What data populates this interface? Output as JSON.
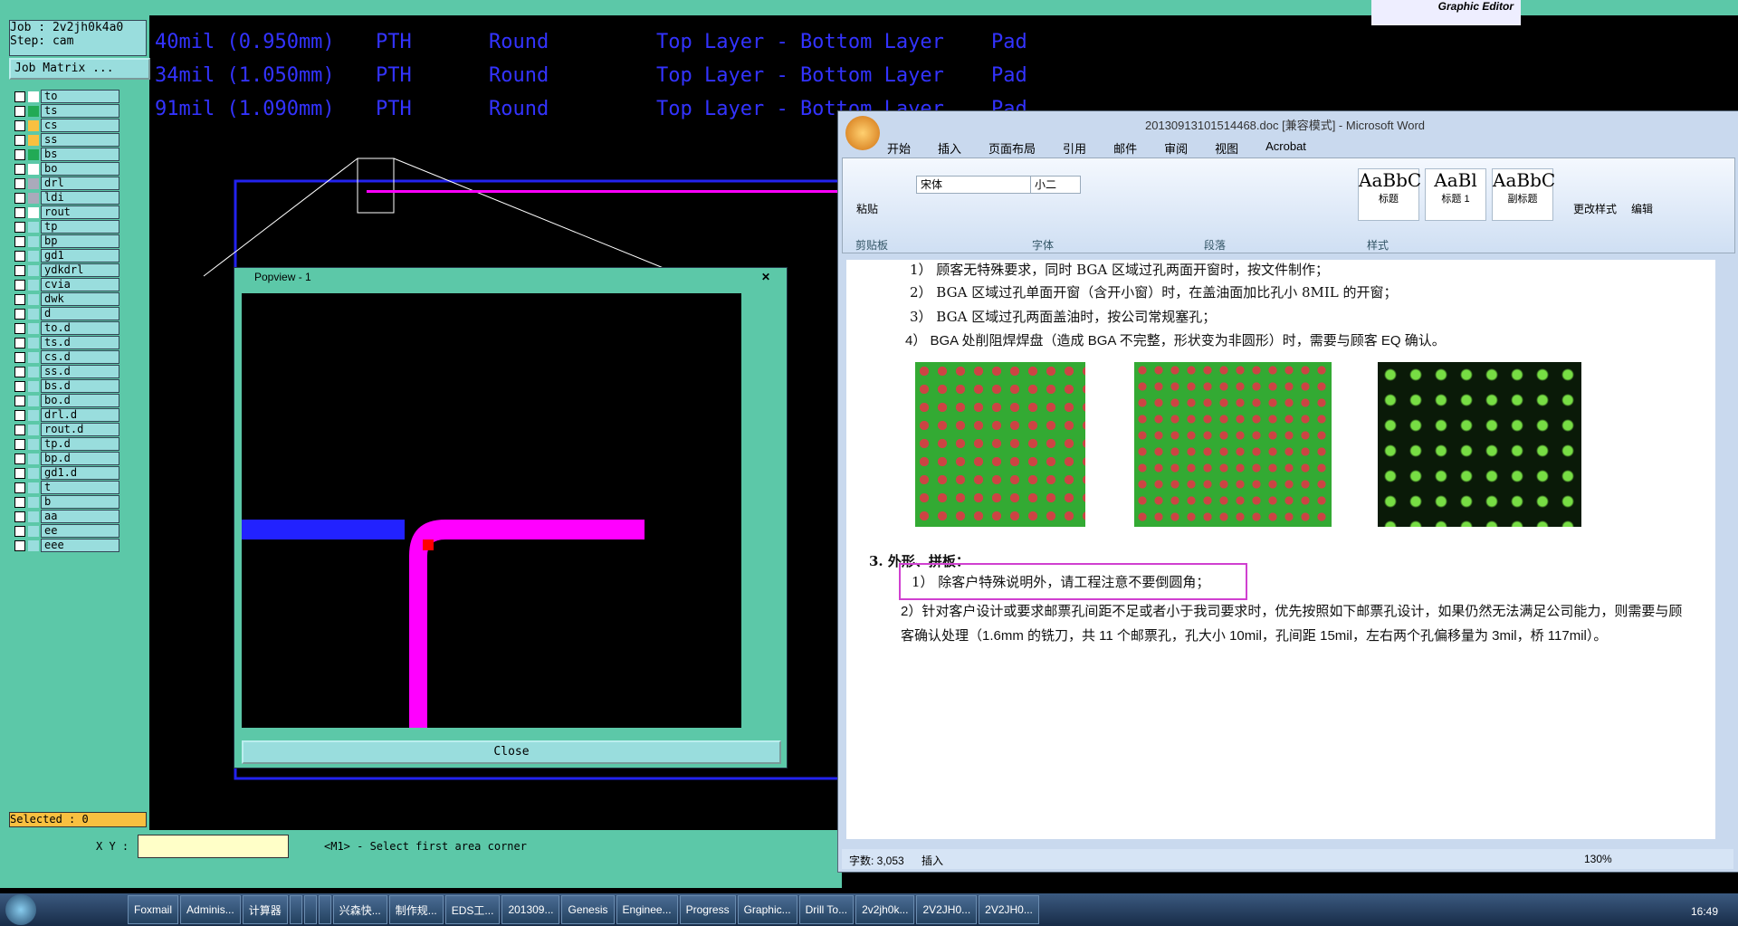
{
  "genesis": {
    "job": "Job : 2v2jh0k4a0",
    "step": "Step: cam",
    "job_matrix": "Job Matrix ...",
    "selected": "Selected : 0",
    "xy_label": "X Y :",
    "status": "<M1> - Select first area corner",
    "title": "Graphic Editor",
    "rows": [
      [
        "40mil (0.950mm)",
        "PTH",
        "Round",
        "Top Layer - Bottom Layer",
        "Pad"
      ],
      [
        "34mil (1.050mm)",
        "PTH",
        "Round",
        "Top Layer - Bottom Layer",
        "Pad"
      ],
      [
        "91mil (1.090mm)",
        "PTH",
        "Round",
        "Top Layer - Bottom Layer",
        "Pad"
      ]
    ],
    "layers": [
      {
        "n": "to",
        "c": "#fff"
      },
      {
        "n": "ts",
        "c": "#22aa55"
      },
      {
        "n": "cs",
        "c": "#f8c040"
      },
      {
        "n": "ss",
        "c": "#f8c040"
      },
      {
        "n": "bs",
        "c": "#22aa55"
      },
      {
        "n": "bo",
        "c": "#fff"
      },
      {
        "n": "drl",
        "c": "#aab"
      },
      {
        "n": "ldi",
        "c": "#aab"
      },
      {
        "n": "rout",
        "c": "#fff"
      },
      {
        "n": "tp",
        "c": "#9dd"
      },
      {
        "n": "bp",
        "c": "#9dd"
      },
      {
        "n": "gd1",
        "c": "#9dd"
      },
      {
        "n": "ydkdrl",
        "c": "#9dd"
      },
      {
        "n": "cvia",
        "c": "#9dd"
      },
      {
        "n": "dwk",
        "c": "#9dd"
      },
      {
        "n": "d",
        "c": "#9dd"
      },
      {
        "n": "to.d",
        "c": "#9dd"
      },
      {
        "n": "ts.d",
        "c": "#9dd"
      },
      {
        "n": "cs.d",
        "c": "#9dd"
      },
      {
        "n": "ss.d",
        "c": "#9dd"
      },
      {
        "n": "bs.d",
        "c": "#9dd"
      },
      {
        "n": "bo.d",
        "c": "#9dd"
      },
      {
        "n": "drl.d",
        "c": "#9dd"
      },
      {
        "n": "rout.d",
        "c": "#9dd"
      },
      {
        "n": "tp.d",
        "c": "#9dd"
      },
      {
        "n": "bp.d",
        "c": "#9dd"
      },
      {
        "n": "gd1.d",
        "c": "#9dd"
      },
      {
        "n": "t",
        "c": "#9dd"
      },
      {
        "n": "b",
        "c": "#9dd"
      },
      {
        "n": "aa",
        "c": "#9dd"
      },
      {
        "n": "ee",
        "c": "#9dd"
      },
      {
        "n": "eee",
        "c": "#9dd"
      }
    ]
  },
  "popview": {
    "title": "Popview - 1",
    "close": "Close"
  },
  "word": {
    "title": "20130913101514468.doc [兼容模式] - Microsoft Word",
    "tabs": [
      "开始",
      "插入",
      "页面布局",
      "引用",
      "邮件",
      "审阅",
      "视图",
      "Acrobat"
    ],
    "font": "宋体",
    "size": "小二",
    "groups": [
      "剪贴板",
      "字体",
      "段落",
      "样式"
    ],
    "paste": "粘贴",
    "styles": [
      {
        "p": "AaBbC",
        "n": "标题"
      },
      {
        "p": "AaBl",
        "n": "标题 1"
      },
      {
        "p": "AaBbC",
        "n": "副标题"
      }
    ],
    "change_style": "更改样式",
    "edit": "编辑",
    "p1": "1） 顾客无特殊要求，同时 BGA 区域过孔两面开窗时，按文件制作；",
    "p2": "2） BGA 区域过孔单面开窗（含开小窗）时，在盖油面加比孔小 8MIL 的开窗；",
    "p3": "3） BGA 区域过孔两面盖油时，按公司常规塞孔；",
    "p4": "4） BGA 处削阻焊焊盘（造成 BGA 不完整，形状变为非圆形）时，需要与顾客 EQ 确认。",
    "h3": "3. 外形、拼板：",
    "p5": "1） 除客户特殊说明外，请工程注意不要倒圆角；",
    "p6": "2）针对客户设计或要求邮票孔间距不足或者小于我司要求时，优先按照如下邮票孔设计，如果仍然无法满足公司能力，则需要与顾客确认处理（1.6mm 的铣刀，共 11 个邮票孔，孔大小 10mil，孔间距 15mil，左右两个孔偏移量为 3mil，桥 117mil）。",
    "words": "字数: 3,053",
    "insert": "插入",
    "zoom": "130%"
  },
  "taskbar": {
    "items": [
      "Foxmail",
      "Adminis...",
      "计算器",
      "",
      "",
      "",
      "兴森快...",
      "制作规...",
      "EDS工...",
      "201309...",
      "Genesis",
      "Enginee...",
      "Progress",
      "Graphic...",
      "Drill To...",
      "2v2jh0k...",
      "2V2JH0...",
      "2V2JH0..."
    ],
    "time": "16:49"
  }
}
